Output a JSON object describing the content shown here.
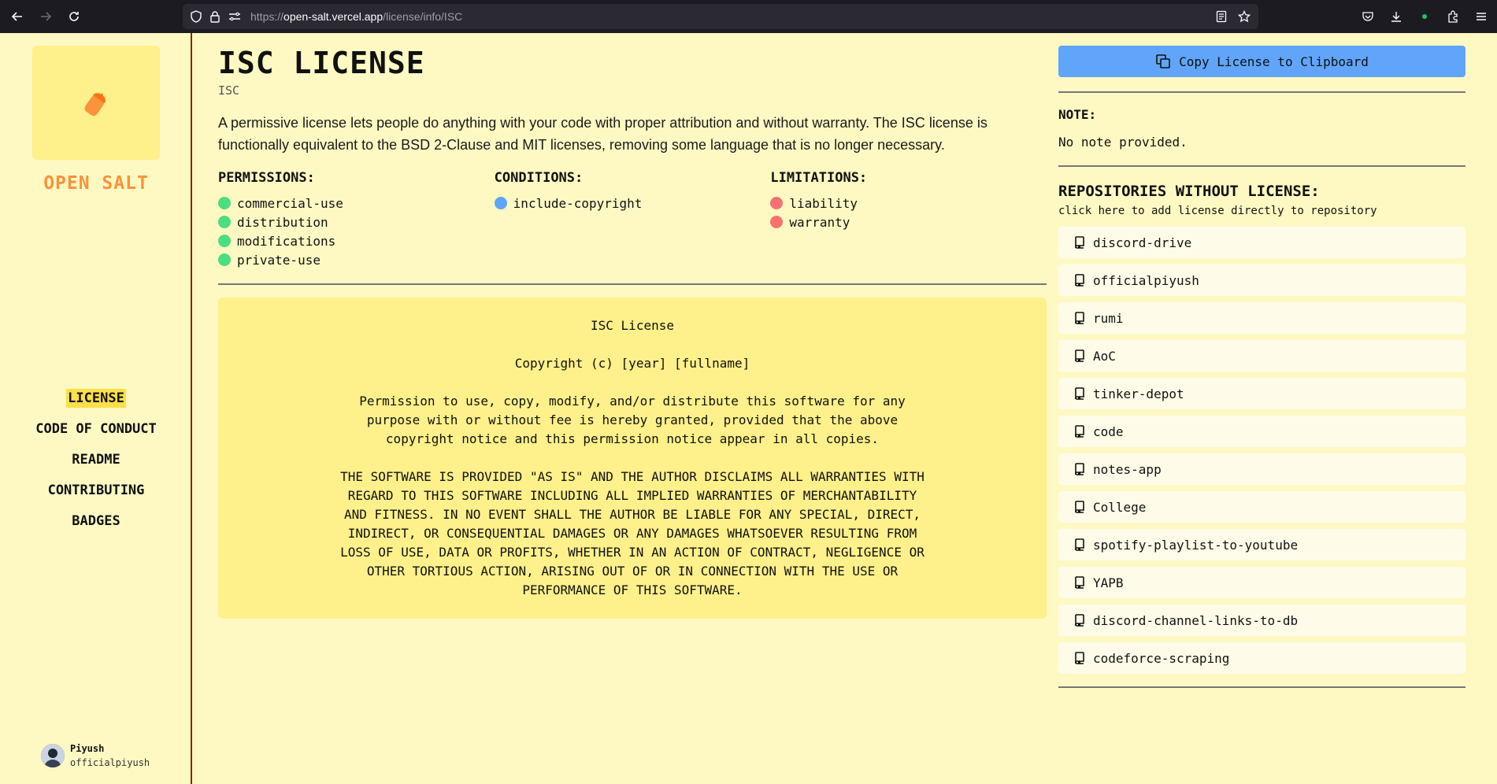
{
  "browser": {
    "url_prefix": "https://",
    "url_host": "open-salt.vercel.app",
    "url_path": "/license/info/ISC"
  },
  "sidebar": {
    "brand": "OPEN SALT",
    "nav": [
      {
        "label": "LICENSE",
        "active": true
      },
      {
        "label": "CODE OF CONDUCT",
        "active": false
      },
      {
        "label": "README",
        "active": false
      },
      {
        "label": "CONTRIBUTING",
        "active": false
      },
      {
        "label": "BADGES",
        "active": false
      }
    ],
    "user": {
      "name": "Piyush",
      "handle": "officialpiyush"
    }
  },
  "license": {
    "title": "ISC LICENSE",
    "spdx": "ISC",
    "description": "A permissive license lets people do anything with your code with proper attribution and without warranty. The ISC license is functionally equivalent to the BSD 2-Clause and MIT licenses, removing some language that is no longer necessary.",
    "permissions_label": "PERMISSIONS:",
    "permissions": [
      "commercial-use",
      "distribution",
      "modifications",
      "private-use"
    ],
    "conditions_label": "CONDITIONS:",
    "conditions": [
      "include-copyright"
    ],
    "limitations_label": "LIMITATIONS:",
    "limitations": [
      "liability",
      "warranty"
    ],
    "text": [
      "ISC License",
      "Copyright (c) [year] [fullname]",
      "Permission to use, copy, modify, and/or distribute this software for any\npurpose with or without fee is hereby granted, provided that the above\ncopyright notice and this permission notice appear in all copies.",
      "THE SOFTWARE IS PROVIDED \"AS IS\" AND THE AUTHOR DISCLAIMS ALL WARRANTIES WITH\nREGARD TO THIS SOFTWARE INCLUDING ALL IMPLIED WARRANTIES OF MERCHANTABILITY\nAND FITNESS. IN NO EVENT SHALL THE AUTHOR BE LIABLE FOR ANY SPECIAL, DIRECT,\nINDIRECT, OR CONSEQUENTIAL DAMAGES OR ANY DAMAGES WHATSOEVER RESULTING FROM\nLOSS OF USE, DATA OR PROFITS, WHETHER IN AN ACTION OF CONTRACT, NEGLIGENCE OR\nOTHER TORTIOUS ACTION, ARISING OUT OF OR IN CONNECTION WITH THE USE OR\nPERFORMANCE OF THIS SOFTWARE."
    ]
  },
  "right": {
    "copy_label": "Copy License to Clipboard",
    "note_label": "NOTE:",
    "note_text": "No note provided.",
    "repos_title": "REPOSITORIES WITHOUT LICENSE:",
    "repos_sub": "click here to add license directly to repository",
    "repos": [
      "discord-drive",
      "officialpiyush",
      "rumi",
      "AoC",
      "tinker-depot",
      "code",
      "notes-app",
      "College",
      "spotify-playlist-to-youtube",
      "YAPB",
      "discord-channel-links-to-db",
      "codeforce-scraping"
    ]
  },
  "colors": {
    "background": "#fef9c3",
    "brand": "#fb923c",
    "accent_button": "#60a5fa",
    "permission_dot": "#4ade80",
    "condition_dot": "#60a5fa",
    "limitation_dot": "#f87171",
    "active_nav": "#fde047"
  }
}
